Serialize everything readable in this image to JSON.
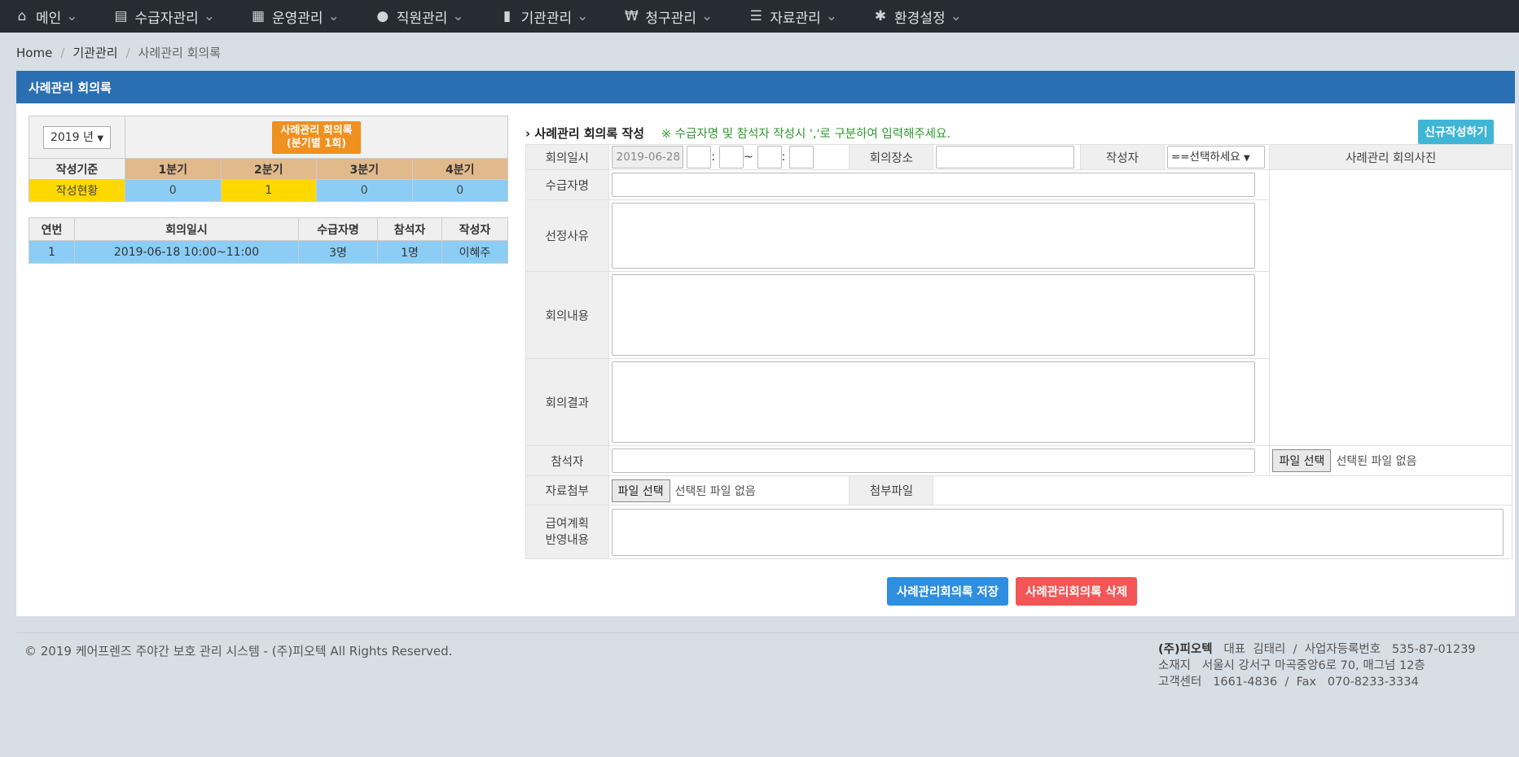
{
  "nav": [
    {
      "label": "메인",
      "icon": "home-icon",
      "glyph": "⌂"
    },
    {
      "label": "수급자관리",
      "icon": "id-card-icon",
      "glyph": "▤"
    },
    {
      "label": "운영관리",
      "icon": "calendar-icon",
      "glyph": "▦"
    },
    {
      "label": "직원관리",
      "icon": "users-icon",
      "glyph": "●"
    },
    {
      "label": "기관관리",
      "icon": "building-icon",
      "glyph": "▮"
    },
    {
      "label": "청구관리",
      "icon": "won-icon",
      "glyph": "₩"
    },
    {
      "label": "자료관리",
      "icon": "list-icon",
      "glyph": "☰"
    },
    {
      "label": "환경설정",
      "icon": "gear-icon",
      "glyph": "✱"
    }
  ],
  "breadcrumb": {
    "home": "Home",
    "section": "기관관리",
    "current": "사례관리 회의록"
  },
  "panel_title": "사례관리 회의록",
  "summary": {
    "year": "2019 년",
    "badge_line1": "사례관리 회의록",
    "badge_line2": "(분기별 1회)",
    "row_label_head": "작성기준",
    "row_label_status": "작성현황",
    "quarters": [
      "1분기",
      "2분기",
      "3분기",
      "4분기"
    ],
    "counts": [
      "0",
      "1",
      "0",
      "0"
    ]
  },
  "list": {
    "headers": [
      "연번",
      "회의일시",
      "수급자명",
      "참석자",
      "작성자"
    ],
    "rows": [
      [
        "1",
        "2019-06-18 10:00~11:00",
        "3명",
        "1명",
        "이혜주"
      ]
    ]
  },
  "form": {
    "title": "사례관리 회의록 작성",
    "note": "※ 수급자명 및 참석자 작성시 ','로 구분하여 입력해주세요.",
    "new_button": "신규작성하기",
    "label_datetime": "회의일시",
    "date_value": "2019-06-28",
    "colon": ":",
    "tilde": "~",
    "label_place": "회의장소",
    "label_author": "작성자",
    "author_select": "==선택하세요",
    "label_photo": "사례관리 회의사진",
    "label_recipient": "수급자명",
    "label_reason": "선정사유",
    "label_content": "회의내용",
    "label_result": "회의결과",
    "label_attendee": "참석자",
    "label_attach": "자료첨부",
    "label_attached": "첨부파일",
    "label_plan1": "급여계획",
    "label_plan2": "반영내용",
    "file_button": "파일 선택",
    "file_none": "선택된 파일 없음",
    "save_button": "사례관리회의록 저장",
    "delete_button": "사례관리회의록 삭제"
  },
  "footer": {
    "copyright": "© 2019 케어프렌즈 주야간 보호 관리 시스템 - (주)피오텍 All Rights Reserved.",
    "company": "(주)피오텍",
    "ceo_label": "대표",
    "ceo": "김태리",
    "slash": "/",
    "biz_label": "사업자등록번호",
    "biz_no": "535-87-01239",
    "addr_label": "소재지",
    "address": "서울시 강서구 마곡중앙6로 70, 매그넘 12층",
    "cs_label": "고객센터",
    "cs": "1661-4836",
    "fax_label": "Fax",
    "fax": "070-8233-3334"
  }
}
